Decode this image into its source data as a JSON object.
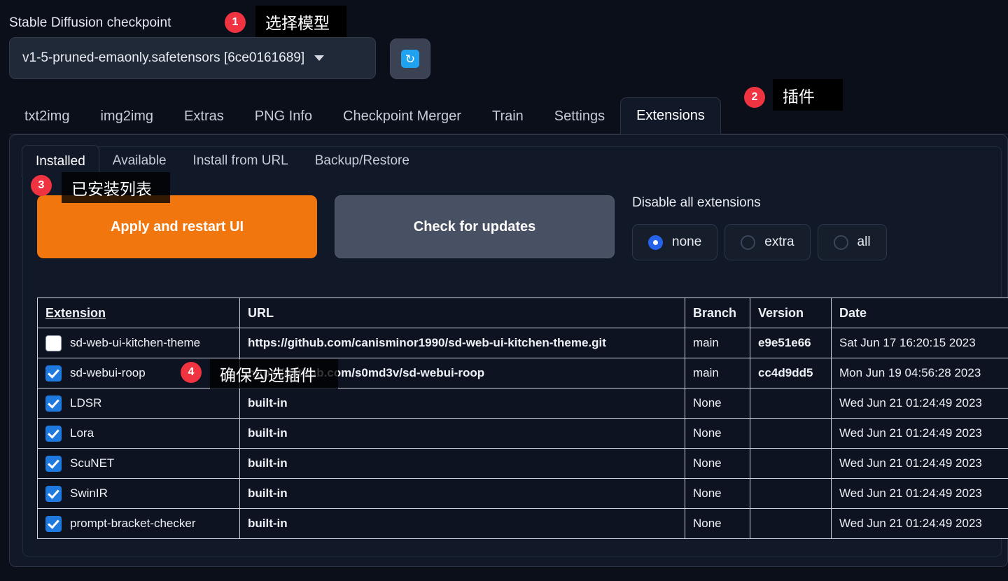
{
  "checkpoint": {
    "label": "Stable Diffusion checkpoint",
    "value": "v1-5-pruned-emaonly.safetensors [6ce0161689]",
    "refresh_icon": "refresh-icon",
    "caret_icon": "chevron-down-icon"
  },
  "main_tabs": [
    {
      "label": "txt2img",
      "active": false
    },
    {
      "label": "img2img",
      "active": false
    },
    {
      "label": "Extras",
      "active": false
    },
    {
      "label": "PNG Info",
      "active": false
    },
    {
      "label": "Checkpoint Merger",
      "active": false
    },
    {
      "label": "Train",
      "active": false
    },
    {
      "label": "Settings",
      "active": false
    },
    {
      "label": "Extensions",
      "active": true
    }
  ],
  "sub_tabs": [
    {
      "label": "Installed",
      "active": true
    },
    {
      "label": "Available",
      "active": false
    },
    {
      "label": "Install from URL",
      "active": false
    },
    {
      "label": "Backup/Restore",
      "active": false
    }
  ],
  "actions": {
    "apply_label": "Apply and restart UI",
    "check_label": "Check for updates"
  },
  "disable_group": {
    "title": "Disable all extensions",
    "options": [
      {
        "label": "none",
        "selected": true
      },
      {
        "label": "extra",
        "selected": false
      },
      {
        "label": "all",
        "selected": false
      }
    ]
  },
  "table": {
    "headers": [
      "Extension",
      "URL",
      "Branch",
      "Version",
      "Date"
    ],
    "rows": [
      {
        "checked": false,
        "name": "sd-web-ui-kitchen-theme",
        "url": "https://github.com/canisminor1990/sd-web-ui-kitchen-theme.git",
        "branch": "main",
        "version": "e9e51e66",
        "date": "Sat Jun 17 16:20:15 2023"
      },
      {
        "checked": true,
        "name": "sd-webui-roop",
        "url": "https://github.com/s0md3v/sd-webui-roop",
        "branch": "main",
        "version": "cc4d9dd5",
        "date": "Mon Jun 19 04:56:28 2023"
      },
      {
        "checked": true,
        "name": "LDSR",
        "url": "built-in",
        "branch": "None",
        "version": "",
        "date": "Wed Jun 21 01:24:49 2023"
      },
      {
        "checked": true,
        "name": "Lora",
        "url": "built-in",
        "branch": "None",
        "version": "",
        "date": "Wed Jun 21 01:24:49 2023"
      },
      {
        "checked": true,
        "name": "ScuNET",
        "url": "built-in",
        "branch": "None",
        "version": "",
        "date": "Wed Jun 21 01:24:49 2023"
      },
      {
        "checked": true,
        "name": "SwinIR",
        "url": "built-in",
        "branch": "None",
        "version": "",
        "date": "Wed Jun 21 01:24:49 2023"
      },
      {
        "checked": true,
        "name": "prompt-bracket-checker",
        "url": "built-in",
        "branch": "None",
        "version": "",
        "date": "Wed Jun 21 01:24:49 2023"
      }
    ]
  },
  "annotations": [
    {
      "number": "1",
      "text": "选择模型"
    },
    {
      "number": "2",
      "text": "插件"
    },
    {
      "number": "3",
      "text": "已安装列表"
    },
    {
      "number": "4",
      "text": "确保勾选插件"
    }
  ],
  "colors": {
    "accent_orange": "#f2760e",
    "accent_blue": "#1f7ae0",
    "badge_red": "#ef3340",
    "page_bg": "#0b0f19",
    "panel_bg": "#111827"
  }
}
